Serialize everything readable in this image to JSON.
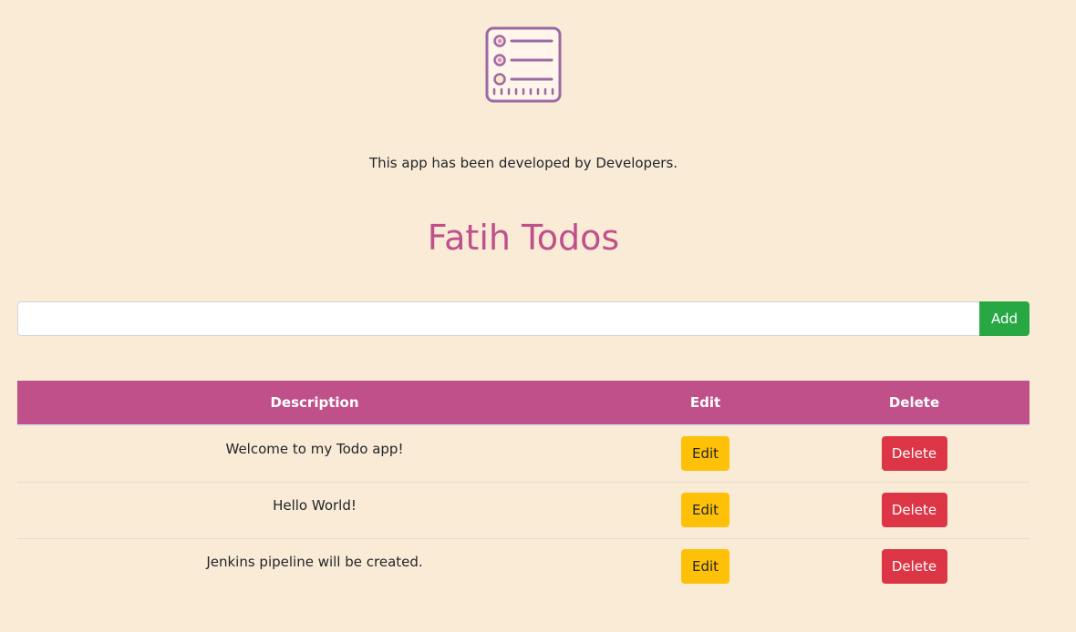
{
  "logo": {
    "icon": "checklist-icon",
    "stroke_color": "#9b6aa3",
    "dot_color": "#e58aa3"
  },
  "credit": "This app has been developed by Developers.",
  "title": "Fatih Todos",
  "input": {
    "value": "",
    "placeholder": ""
  },
  "add_label": "Add",
  "table": {
    "headers": [
      "Description",
      "Edit",
      "Delete"
    ],
    "rows": [
      {
        "description": "Welcome to my Todo app!",
        "edit_label": "Edit",
        "delete_label": "Delete"
      },
      {
        "description": "Hello World!",
        "edit_label": "Edit",
        "delete_label": "Delete"
      },
      {
        "description": "Jenkins pipeline will be created.",
        "edit_label": "Edit",
        "delete_label": "Delete"
      }
    ]
  },
  "colors": {
    "background": "#faebd7",
    "accent": "#bf508a",
    "add": "#28a745",
    "edit": "#ffc107",
    "delete": "#dc3545"
  }
}
